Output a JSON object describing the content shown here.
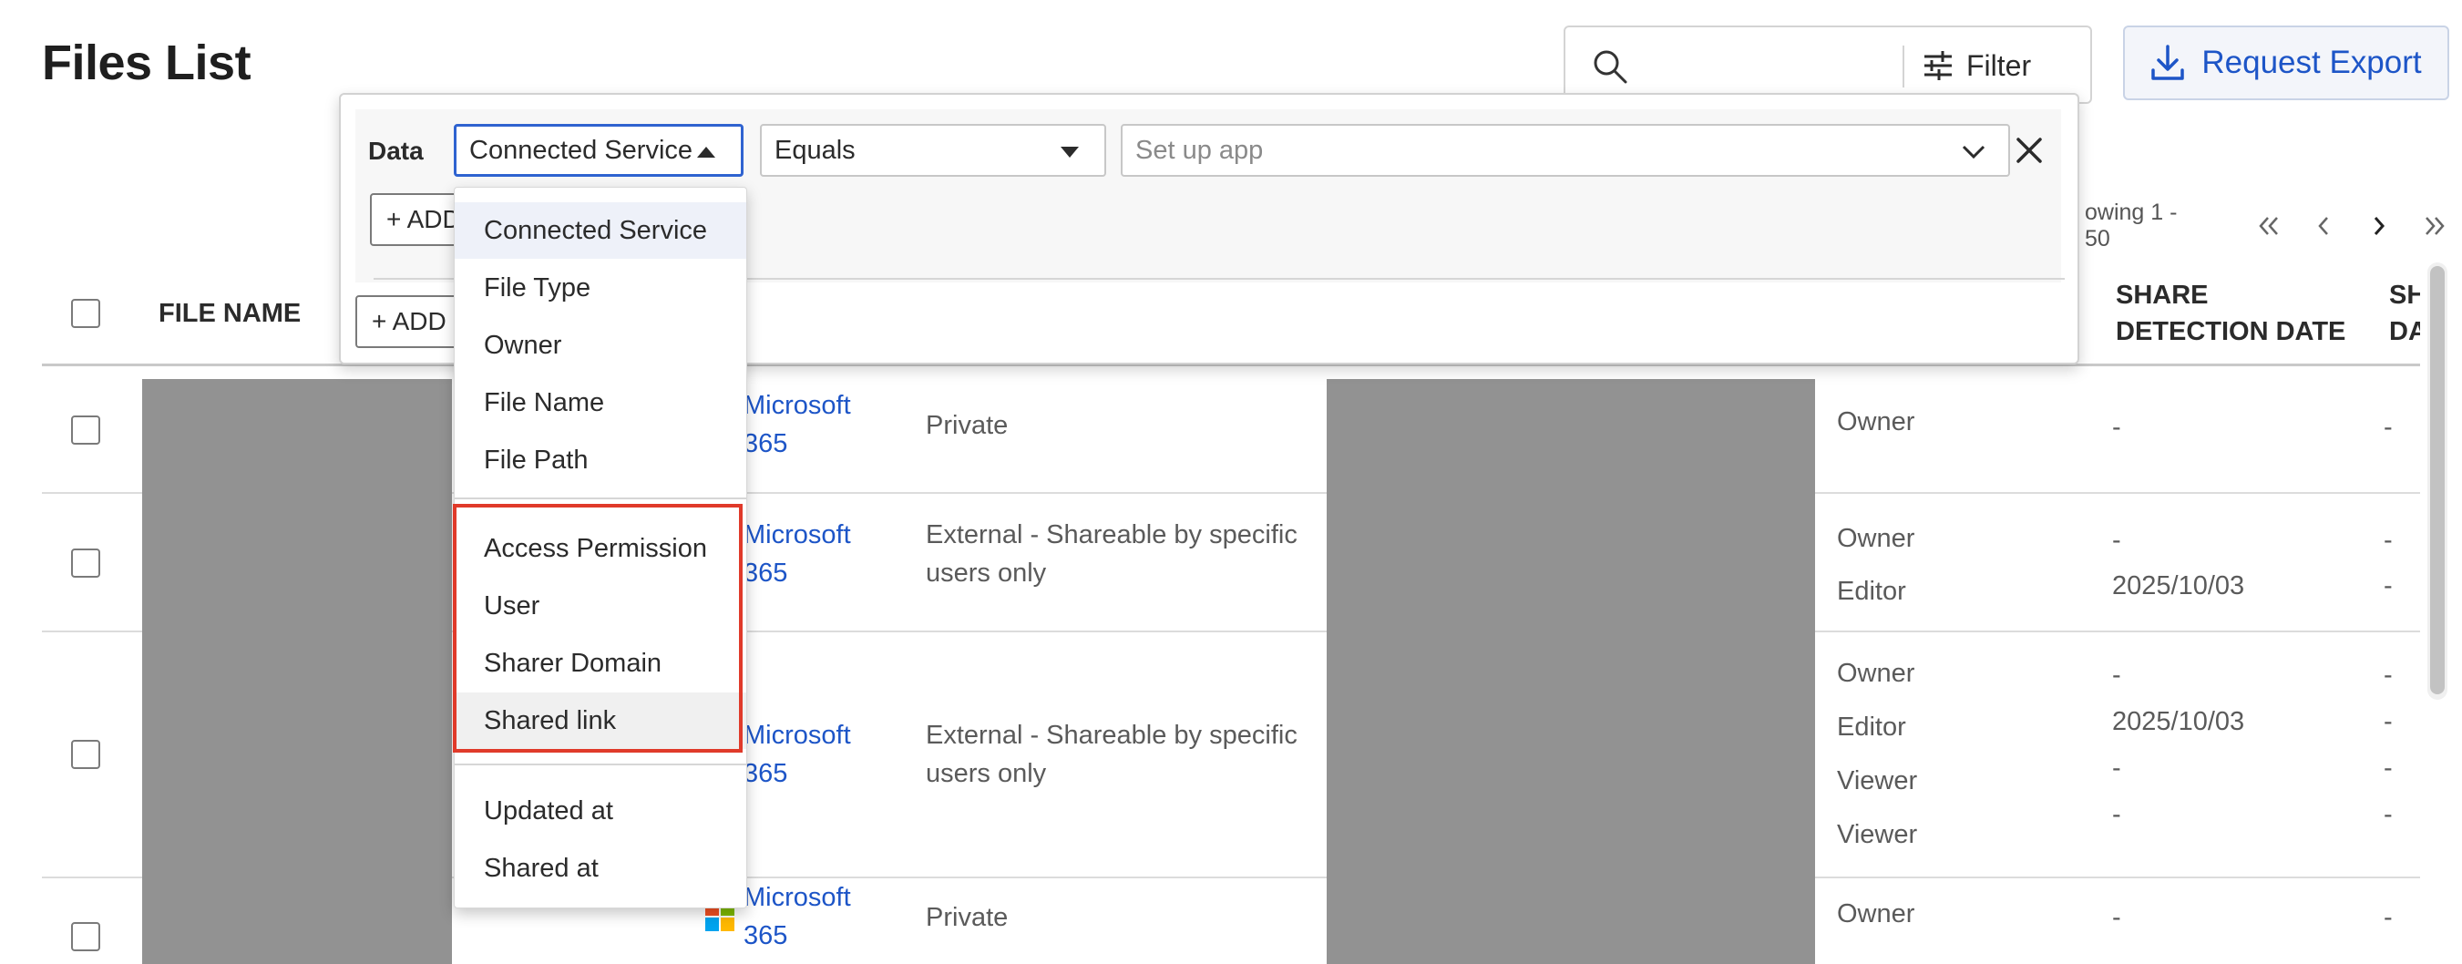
{
  "page": {
    "title": "Files List"
  },
  "toolbar": {
    "search_value": "",
    "filter_label": "Filter",
    "export_label": "Request Export"
  },
  "pager": {
    "showing": "owing 1 - 50"
  },
  "table": {
    "headers": {
      "file_name": "FILE NAME",
      "share_detection_date_1": "SHARE",
      "share_detection_date_2": "DETECTION DATE",
      "sh_1": "SH",
      "sh_2": "DA"
    },
    "rows": [
      {
        "service": [
          "Microsoft",
          "365"
        ],
        "access": [
          "Private"
        ],
        "roles": [
          "Owner"
        ],
        "dates": [
          "-"
        ],
        "last": [
          "-"
        ]
      },
      {
        "service": [
          "Microsoft",
          "365"
        ],
        "access": [
          "External - Shareable by specific",
          "users only"
        ],
        "roles": [
          "Owner",
          "Editor"
        ],
        "dates": [
          "-",
          "2025/10/03"
        ],
        "last": [
          "-",
          "-"
        ]
      },
      {
        "service": [
          "Microsoft",
          "365"
        ],
        "access": [
          "External - Shareable by specific",
          "users only"
        ],
        "roles": [
          "Owner",
          "Editor",
          "Viewer",
          "Viewer"
        ],
        "dates": [
          "-",
          "2025/10/03",
          "-",
          "-"
        ],
        "last": [
          "-",
          "-",
          "-",
          "-"
        ]
      },
      {
        "service": [
          "Microsoft",
          "365"
        ],
        "access": [
          "Private"
        ],
        "roles": [
          "Owner"
        ],
        "dates": [
          "-"
        ],
        "last": [
          "-"
        ]
      }
    ]
  },
  "filter_panel": {
    "data_label": "Data",
    "field_select": "Connected Service",
    "operator_select": "Equals",
    "value_placeholder": "Set up app",
    "add_condition_1": "+ ADD",
    "add_condition_2": "+ ADD C"
  },
  "dropdown": {
    "group1": [
      "Connected Service",
      "File Type",
      "Owner",
      "File Name",
      "File Path"
    ],
    "group2": [
      "Access Permission",
      "User",
      "Sharer Domain",
      "Shared link"
    ],
    "group3": [
      "Updated at",
      "Shared at"
    ]
  },
  "colors": {
    "accent": "#1d55c7",
    "highlight": "#e03a2a",
    "redaction": "#929292"
  }
}
